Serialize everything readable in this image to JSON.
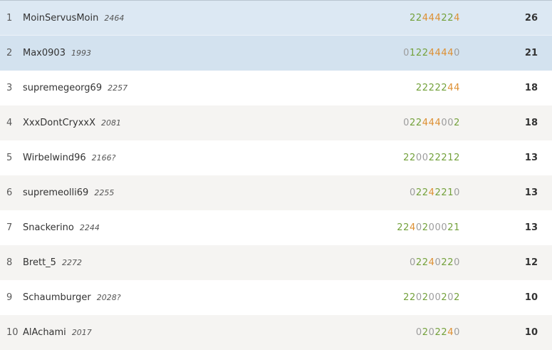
{
  "colors": {
    "highlight_row_1": "#dce8f3",
    "highlight_row_2": "#d3e2ef",
    "zebra_row": "#f5f4f2",
    "result_win": "#73a13b",
    "result_top": "#dd8f31",
    "result_zero": "#9c9c9c"
  },
  "standings": [
    {
      "rank": "1",
      "name": "MoinServusMoin",
      "rating": "2464",
      "results": "22444224",
      "score": "26"
    },
    {
      "rank": "2",
      "name": "Max0903",
      "rating": "1993",
      "results": "012244440",
      "score": "21"
    },
    {
      "rank": "3",
      "name": "supremegeorg69",
      "rating": "2257",
      "results": "2222244",
      "score": "18"
    },
    {
      "rank": "4",
      "name": "XxxDontCryxxX",
      "rating": "2081",
      "results": "022444002",
      "score": "18"
    },
    {
      "rank": "5",
      "name": "Wirbelwind96",
      "rating": "2166?",
      "results": "220022212",
      "score": "13"
    },
    {
      "rank": "6",
      "name": "supremeolli69",
      "rating": "2255",
      "results": "02242210",
      "score": "13"
    },
    {
      "rank": "7",
      "name": "Snackerino",
      "rating": "2244",
      "results": "2240200021",
      "score": "13"
    },
    {
      "rank": "8",
      "name": "Brett_5",
      "rating": "2272",
      "results": "02240220",
      "score": "12"
    },
    {
      "rank": "9",
      "name": "Schaumburger",
      "rating": "2028?",
      "results": "220200202",
      "score": "10"
    },
    {
      "rank": "10",
      "name": "AlAchami",
      "rating": "2017",
      "results": "0202240",
      "score": "10"
    }
  ]
}
